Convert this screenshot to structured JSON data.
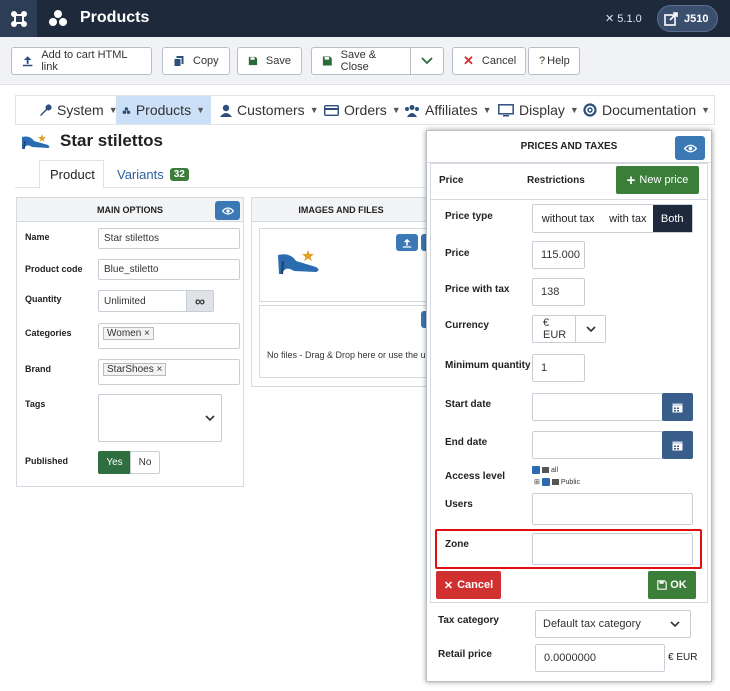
{
  "header": {
    "title": "Products",
    "version": "5.1.0",
    "user": "J510"
  },
  "toolbar": {
    "add_cart": "Add to cart HTML link",
    "copy": "Copy",
    "save": "Save",
    "save_close": "Save & Close",
    "cancel": "Cancel",
    "help": "Help"
  },
  "menu": [
    {
      "label": "System"
    },
    {
      "label": "Products"
    },
    {
      "label": "Customers"
    },
    {
      "label": "Orders"
    },
    {
      "label": "Affiliates"
    },
    {
      "label": "Display"
    },
    {
      "label": "Documentation"
    }
  ],
  "product": {
    "title": "Star stilettos"
  },
  "tabs": {
    "product": "Product",
    "variants": "Variants",
    "variants_count": "32"
  },
  "main_options": {
    "header": "MAIN OPTIONS",
    "name_label": "Name",
    "name_value": "Star stilettos",
    "code_label": "Product code",
    "code_value": "Blue_stiletto",
    "qty_label": "Quantity",
    "qty_value": "Unlimited",
    "qty_symbol": "∞",
    "categories_label": "Categories",
    "category": "Women",
    "brand_label": "Brand",
    "brand": "StarShoes",
    "tags_label": "Tags",
    "published_label": "Published",
    "yes": "Yes",
    "no": "No"
  },
  "images": {
    "header": "IMAGES AND FILES",
    "no_files": "No files - Drag & Drop here or use the uplo"
  },
  "prices": {
    "header": "PRICES AND TAXES",
    "tab_price": "Price",
    "tab_restrictions": "Restrictions",
    "new_price": "New price",
    "price_type_label": "Price type",
    "pt_without": "without tax",
    "pt_with": "with tax",
    "pt_both": "Both",
    "price_label": "Price",
    "price_value": "115.000",
    "pwt_label": "Price with tax",
    "pwt_value": "138",
    "currency_label": "Currency",
    "currency_value": "€ EUR",
    "min_qty_label": "Minimum quantity",
    "min_qty_value": "1",
    "start_label": "Start date",
    "end_label": "End date",
    "access_label": "Access level",
    "access_all": "all",
    "access_public": "Public",
    "users_label": "Users",
    "zone_label": "Zone",
    "cancel": "Cancel",
    "ok": "OK",
    "tax_cat_label": "Tax category",
    "tax_cat_value": "Default tax category",
    "retail_label": "Retail price",
    "retail_value": "0.0000000",
    "retail_currency": "€ EUR"
  },
  "colors": {
    "header_bg": "#1e2a3b",
    "accent_blue": "#3a78b6",
    "green": "#3a7e3a",
    "red": "#d03030",
    "highlight": "#e01010"
  }
}
